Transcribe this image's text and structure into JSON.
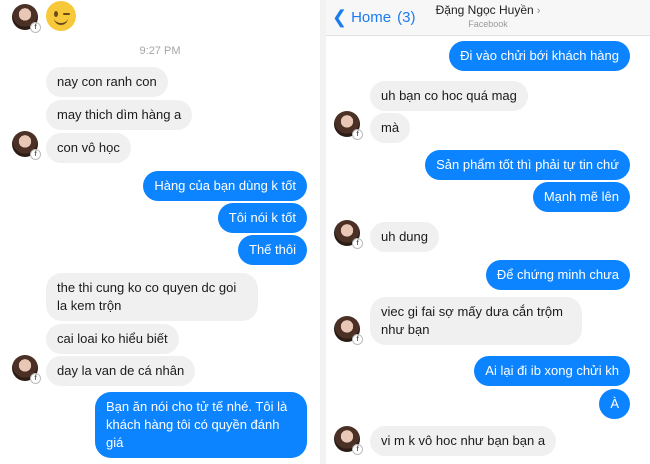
{
  "left": {
    "timestamp": "9:27 PM",
    "messages": [
      {
        "text": "nay con ranh con"
      },
      {
        "text": "may thich dìm hàng a"
      },
      {
        "text": "con vô học"
      },
      {
        "text": "Hàng của bạn dùng k tốt"
      },
      {
        "text": "Tôi nói k tốt"
      },
      {
        "text": "Thế thôi"
      },
      {
        "text": "the thi cung ko co quyen dc goi la kem trộn"
      },
      {
        "text": "cai loai ko hiểu biết"
      },
      {
        "text": "day la van de cá nhân"
      },
      {
        "text": "Bạn ăn nói cho tử tế nhé. Tôi là khách hàng tôi có quyền đánh giá"
      }
    ]
  },
  "right": {
    "header": {
      "back_label": "Home",
      "unread_count": "(3)",
      "contact_name": "Đặng Ngọc Huyền",
      "contact_sub": "Facebook"
    },
    "messages": [
      {
        "text": "Đi vào chửi bới khách hàng"
      },
      {
        "text": "uh bạn co hoc quá mag"
      },
      {
        "text": "mà"
      },
      {
        "text": "Sản phẩm tốt thì phải tự tin chứ"
      },
      {
        "text": "Mạnh mẽ lên"
      },
      {
        "text": "uh dung"
      },
      {
        "text": "Để chứng minh chưa"
      },
      {
        "text": "viec gi fai sợ mấy dưa cắn trộm như bạn"
      },
      {
        "text": "Ai lại đi ib xong chửi kh"
      },
      {
        "text": "À"
      },
      {
        "text": "vi m k vô hoc như bạn bạn a"
      }
    ]
  },
  "colors": {
    "outgoing_bubble": "#0d84ff",
    "incoming_bubble": "#f0f0f0",
    "accent": "#1a7cf0"
  }
}
